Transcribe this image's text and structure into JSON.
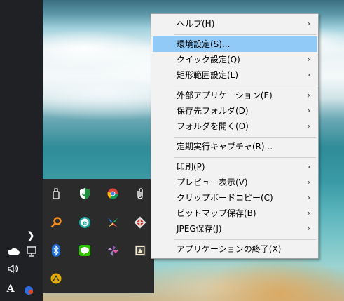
{
  "taskbar": {
    "overflow_chevron": "❯",
    "volume_label": "🔊)",
    "ime_label": "A"
  },
  "tray_icons": [
    {
      "name": "usb-drive-icon"
    },
    {
      "name": "shield-check-icon"
    },
    {
      "name": "chrome-icon"
    },
    {
      "name": "paperclip-icon"
    },
    {
      "name": "magnifier-icon"
    },
    {
      "name": "e-app-icon"
    },
    {
      "name": "pinwheel-icon"
    },
    {
      "name": "puzzle-icon"
    },
    {
      "name": "bluetooth-icon"
    },
    {
      "name": "line-chat-icon"
    },
    {
      "name": "windmill-icon"
    },
    {
      "name": "screen-capture-icon"
    },
    {
      "name": "warning-icon"
    }
  ],
  "menu": {
    "items": [
      {
        "label": "ヘルプ(H)",
        "submenu": true,
        "highlighted": false
      },
      {
        "label": "環境設定(S)...",
        "submenu": false,
        "highlighted": true
      },
      {
        "label": "クイック設定(Q)",
        "submenu": true,
        "highlighted": false
      },
      {
        "label": "矩形範囲設定(L)",
        "submenu": true,
        "highlighted": false
      },
      {
        "label": "外部アプリケーション(E)",
        "submenu": true,
        "highlighted": false
      },
      {
        "label": "保存先フォルダ(D)",
        "submenu": true,
        "highlighted": false
      },
      {
        "label": "フォルダを開く(O)",
        "submenu": true,
        "highlighted": false
      },
      {
        "label": "定期実行キャプチャ(R)...",
        "submenu": false,
        "highlighted": false
      },
      {
        "label": "印刷(P)",
        "submenu": true,
        "highlighted": false
      },
      {
        "label": "プレビュー表示(V)",
        "submenu": true,
        "highlighted": false
      },
      {
        "label": "クリップボードコピー(C)",
        "submenu": true,
        "highlighted": false
      },
      {
        "label": "ビットマップ保存(B)",
        "submenu": true,
        "highlighted": false
      },
      {
        "label": "JPEG保存(J)",
        "submenu": true,
        "highlighted": false
      },
      {
        "label": "アプリケーションの終了(X)",
        "submenu": false,
        "highlighted": false
      }
    ],
    "submenu_arrow": "›"
  },
  "colors": {
    "menu_highlight": "#91c9f7",
    "menu_background": "#f2f2f2",
    "taskbar_background": "#202124",
    "tray_panel_background": "#2b2b2b"
  }
}
